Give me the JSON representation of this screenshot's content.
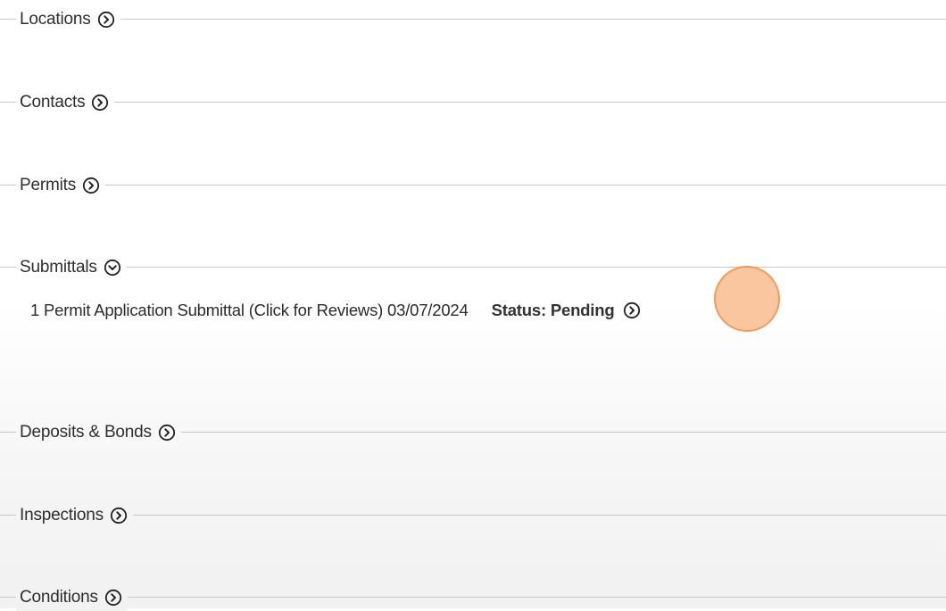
{
  "sections": {
    "locations": {
      "label": "Locations",
      "expanded": false
    },
    "contacts": {
      "label": "Contacts",
      "expanded": false
    },
    "permits": {
      "label": "Permits",
      "expanded": false
    },
    "submittals": {
      "label": "Submittals",
      "expanded": true,
      "items": [
        {
          "title": "1 Permit Application Submittal (Click for Reviews) 03/07/2024",
          "status": "Status: Pending"
        }
      ]
    },
    "deposits_bonds": {
      "label": "Deposits & Bonds",
      "expanded": false
    },
    "inspections": {
      "label": "Inspections",
      "expanded": false
    },
    "conditions": {
      "label": "Conditions",
      "expanded": false
    }
  },
  "colors": {
    "rule": "#c7c7c7",
    "text": "#2b2b2b",
    "click_marker": "#f5a05f"
  },
  "icons": {
    "collapsed": "chevron-right-circle-icon",
    "expanded": "chevron-down-circle-icon"
  }
}
